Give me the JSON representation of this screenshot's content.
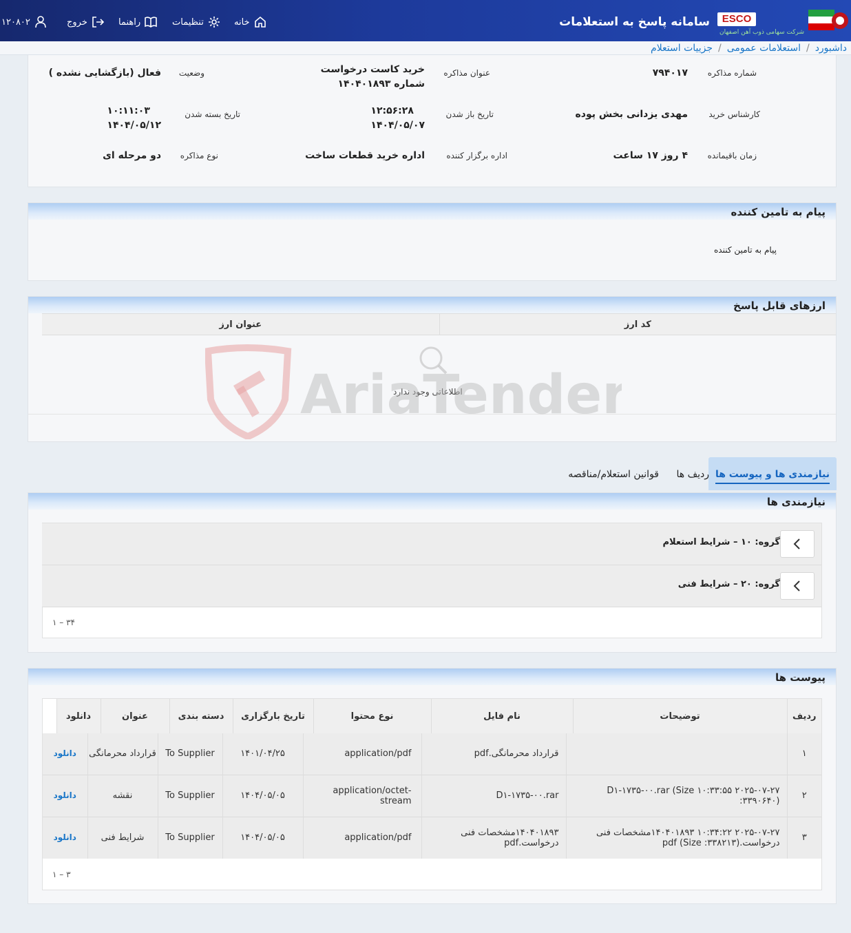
{
  "header": {
    "system_title": "سامانه پاسخ به استعلامات",
    "brand": "ESCO",
    "company": "شرکت سهامی ذوب آهن اصفهان",
    "nav": {
      "home": "خانه",
      "settings": "تنظیمات",
      "guide": "راهنما",
      "logout": "خروج",
      "user_id": "۱۲۰۸۰۲"
    }
  },
  "breadcrumb": [
    "داشبورد",
    "استعلامات عمومی",
    "جزییات استعلام"
  ],
  "details": {
    "negotiation_number_label": "شماره مذاکره",
    "negotiation_number": "۷۹۴۰۱۷",
    "negotiation_title_label": "عنوان مذاکره",
    "negotiation_title_line1": "خرید کاست درخواست",
    "negotiation_title_line2": "شماره ۱۴۰۴۰۱۸۹۳",
    "status_label": "وضعیت",
    "status": "فعال (بازگشایی نشده )",
    "buyer_label": "کارشناس خرید",
    "buyer": "مهدی یزدانی بخش پوده",
    "open_date_label": "تاریخ باز شدن",
    "open_time": "۱۲:۵۶:۲۸",
    "open_date": "۱۴۰۴/۰۵/۰۷",
    "close_date_label": "تاریخ بسته شدن",
    "close_time": "۱۰:۱۱:۰۳",
    "close_date": "۱۴۰۴/۰۵/۱۲",
    "remaining_label": "زمان باقیمانده",
    "remaining": "۴ روز ۱۷ ساعت",
    "organizer_label": "اداره برگزار کننده",
    "organizer": "اداره خرید قطعات ساخت",
    "type_label": "نوع مذاکره",
    "type": "دو مرحله ای"
  },
  "supplier_message": {
    "title": "پیام به تامین کننده",
    "text": "پیام به تامین کننده"
  },
  "currencies": {
    "title": "ارزهای قابل پاسخ",
    "columns": [
      "کد ارز",
      "عنوان ارز"
    ],
    "empty_text": "اطلاعاتی وجود ندارد"
  },
  "watermark": "AriaTender.neT",
  "tabs": [
    "نیازمندی ها و پیوست ها",
    "ردیف ها",
    "قوانین استعلام/مناقصه"
  ],
  "requirements": {
    "title": "نیازمندی ها",
    "groups": [
      "گروه: ۱۰ – شرایط استعلام",
      "گروه: ۲۰ – شرایط فنی"
    ],
    "pager": "۱ – ۳۴"
  },
  "attachments": {
    "title": "پیوست ها",
    "columns": [
      "ردیف",
      "توضیحات",
      "نام فایل",
      "نوع محتوا",
      "تاریخ بارگزاری",
      "دسته بندی",
      "عنوان",
      "دانلود"
    ],
    "rows": [
      {
        "row": "۱",
        "desc": "",
        "file": "قرارداد محرمانگی.pdf",
        "type": "application/pdf",
        "date": "۱۴۰۱/۰۴/۲۵",
        "category": "To Supplier",
        "title": "قرارداد محرمانگی",
        "download": "دانلود"
      },
      {
        "row": "۲",
        "desc": "۲۰۲۵-۰۷-۲۷ ۱۰:۳۳:۵۵ D۱-۱۷۳۵-۰۰.rar (Size :۳۳۹۰۶۴۰)",
        "file": "D۱-۱۷۳۵-۰۰.rar",
        "type": "application/octet-stream",
        "date": "۱۴۰۴/۰۵/۰۵",
        "category": "To Supplier",
        "title": "نقشه",
        "download": "دانلود"
      },
      {
        "row": "۳",
        "desc": "۲۰۲۵-۰۷-۲۷ ۱۰:۳۴:۲۲ ۱۴۰۴۰۱۸۹۳مشخصات فنی درخواست.pdf (Size :۳۳۸۲۱۳)",
        "file": "۱۴۰۴۰۱۸۹۳مشخصات فنی درخواست.pdf",
        "type": "application/pdf",
        "date": "۱۴۰۴/۰۵/۰۵",
        "category": "To Supplier",
        "title": "شرایط فنی",
        "download": "دانلود"
      }
    ],
    "pager": "۱ – ۳"
  }
}
